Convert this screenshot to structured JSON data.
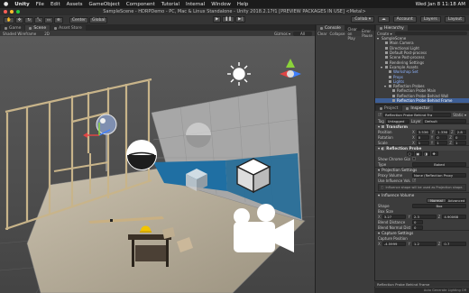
{
  "menubar": {
    "apple": "",
    "app": "Unity",
    "items": [
      "File",
      "Edit",
      "Assets",
      "GameObject",
      "Component",
      "Tutorial",
      "Internal",
      "Window",
      "Help"
    ],
    "clock": "Wed Jan 8 11:18 AM"
  },
  "window": {
    "title": "SampleScene - HDRPDemo - PC, Mac & Linux Standalone - Unity 2018.2.17f1 [PREVIEW PACKAGES IN USE] <Metal>"
  },
  "toolbar": {
    "pivot": "Center",
    "space": "Global",
    "collab": "Collab ▾",
    "account": "Account",
    "layers": "Layers",
    "layout": "Layout"
  },
  "scene_panel": {
    "tabs": [
      "Game",
      "Scene",
      "Asset Store"
    ],
    "shading": "Shaded Wireframe",
    "mode": "2D",
    "gizmos": "Gizmos ▾",
    "search": "All"
  },
  "console": {
    "tab": "Console",
    "buttons": [
      "Clear",
      "Collapse",
      "Clear on Play",
      "Error Pause"
    ]
  },
  "hierarchy": {
    "tab": "Hierarchy",
    "create": "Create ▾",
    "rows": [
      {
        "label": "SampleScene",
        "indent": 0
      },
      {
        "label": "Main Camera",
        "indent": 1
      },
      {
        "label": "Directional Light",
        "indent": 1
      },
      {
        "label": "Default Post-process",
        "indent": 1
      },
      {
        "label": "Scene Post-process",
        "indent": 1
      },
      {
        "label": "Rendering Settings",
        "indent": 1
      },
      {
        "label": "Example Assets",
        "indent": 1
      },
      {
        "label": "Workshop Set",
        "indent": 2
      },
      {
        "label": "Props",
        "indent": 2
      },
      {
        "label": "Lights",
        "indent": 2
      },
      {
        "label": "Reflection Probes",
        "indent": 2
      },
      {
        "label": "Reflection Probe Main",
        "indent": 3
      },
      {
        "label": "Reflection Probe Behind Wall",
        "indent": 3
      },
      {
        "label": "Reflection Probe Behind Frame",
        "indent": 3
      }
    ]
  },
  "inspector": {
    "tabs": [
      "Project",
      "Inspector"
    ],
    "object_name": "Reflection Probe Behind Fra",
    "static": "Static ▾",
    "tag_label": "Tag",
    "tag_value": "Untagged",
    "layer_label": "Layer",
    "layer_value": "Default",
    "transform": {
      "title": "Transform",
      "position": {
        "label": "Position",
        "x": "3.536",
        "y": "1.336",
        "z": "2.8"
      },
      "rotation": {
        "label": "Rotation",
        "x": "0",
        "y": "0",
        "z": "0"
      },
      "scale": {
        "label": "Scale",
        "x": "1",
        "y": "1",
        "z": "1"
      }
    },
    "reflection_probe": {
      "title": "Reflection Probe",
      "show_chrome_gizmo": "Show Chrome Gizmo",
      "type_label": "Type",
      "type_value": "Baked",
      "projection_settings": "Projection Settings",
      "proxy_volume_label": "Proxy Volume",
      "proxy_volume_value": "None (Reflection Proxy",
      "use_influence_label": "Use Influence Volume",
      "help_text": "Influence shape will be used as Projection shape.",
      "influence_volume": "Influence Volume",
      "normal_btn": "Normal",
      "advanced_btn": "Advanced",
      "shape_label": "Shape",
      "shape_value": "Box",
      "box_size_label": "Box Size",
      "box_size": {
        "x": "3.27",
        "y": "2.3",
        "z": "4.90068"
      },
      "blend_distance_label": "Blend Distance",
      "blend_distance": "0",
      "blend_normal_label": "Blend Normal Dista",
      "blend_normal": "0",
      "capture_settings": "Capture Settings",
      "capture_position_label": "Capture Position",
      "capture_position": {
        "x": "-4.5999",
        "y": "1.2",
        "z": "0.7"
      }
    },
    "footer_label": "Reflection Probe Behind Frame",
    "status": "Auto Generate Lighting Off"
  },
  "colors": {
    "selection": "#3e5f96",
    "axis_x": "#e04545",
    "axis_y": "#8bd33a",
    "axis_z": "#3f7fff",
    "water": "#1f6fa3"
  },
  "icons": [
    "apple-icon",
    "play-icon",
    "pause-icon",
    "step-icon",
    "hand-tool-icon",
    "move-tool-icon",
    "rotate-tool-icon",
    "scale-tool-icon",
    "rect-tool-icon",
    "transform-tool-icon",
    "cloud-icon",
    "sun-icon",
    "camera-icon",
    "reflection-probe-icon",
    "light-probe-icon",
    "scene-gizmo-icon"
  ]
}
